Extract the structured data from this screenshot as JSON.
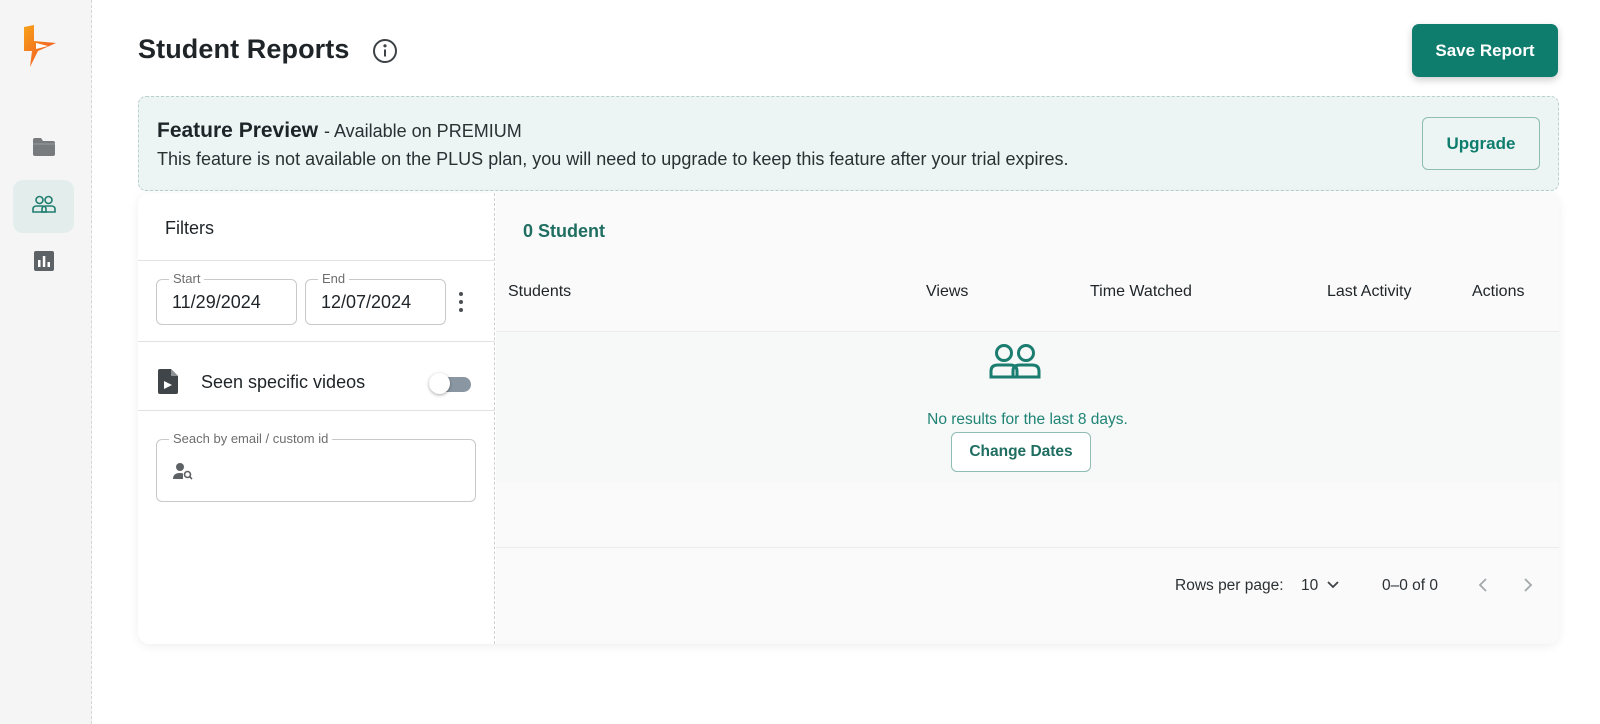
{
  "sidebar": {
    "logo_icon": "bolt-play-logo",
    "items": [
      {
        "icon": "folder-icon",
        "active": false
      },
      {
        "icon": "users-icon",
        "active": true
      },
      {
        "icon": "bar-chart-icon",
        "active": false
      }
    ]
  },
  "header": {
    "title": "Student Reports",
    "info_icon": "info-icon",
    "save_label": "Save Report"
  },
  "banner": {
    "title": "Feature Preview",
    "subtitle": "- Available on PREMIUM",
    "text": "This feature is not available on the PLUS plan, you will need to upgrade to keep this feature after your trial expires.",
    "upgrade_label": "Upgrade"
  },
  "filters": {
    "title": "Filters",
    "start_label": "Start",
    "start_value": "11/29/2024",
    "end_label": "End",
    "end_value": "12/07/2024",
    "videos_label": "Seen specific videos",
    "videos_toggle_on": false,
    "search_label": "Seach by email / custom id",
    "search_value": ""
  },
  "results": {
    "count_label": "0 Student",
    "columns": [
      "Students",
      "Views",
      "Time Watched",
      "Last Activity",
      "Actions"
    ],
    "empty_text": "No results for the last 8 days.",
    "change_dates_label": "Change Dates"
  },
  "pagination": {
    "rows_label": "Rows per page:",
    "rows_value": "10",
    "range": "0–0 of 0"
  },
  "colors": {
    "accent": "#0f7d6e",
    "banner_bg": "#ecf5f3",
    "sidebar_bg": "#f5f5f5"
  }
}
